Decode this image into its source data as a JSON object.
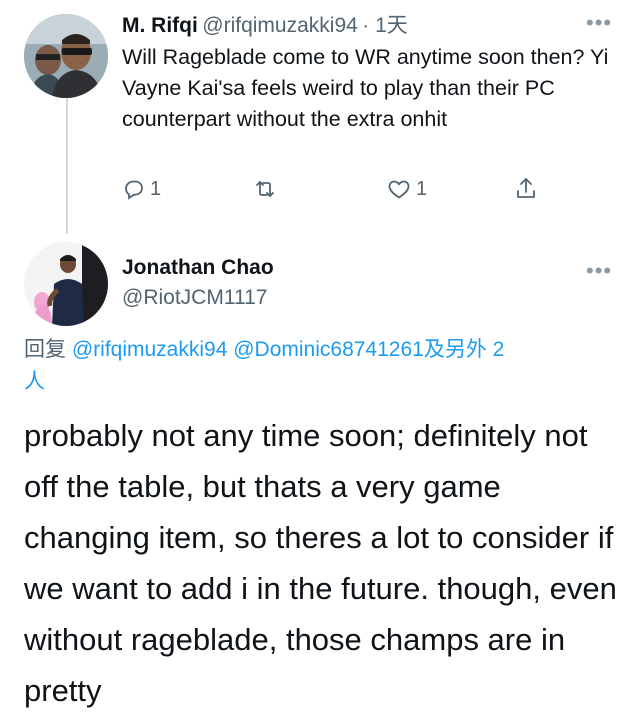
{
  "tweet1": {
    "author_name": "M. Rifqi",
    "author_handle": "@rifqimuzakki94",
    "time": "· 1天",
    "more": "•••",
    "text": "Will Rageblade come to WR anytime soon then? Yi Vayne Kai'sa feels weird to play than their PC counterpart without the extra onhit",
    "reply_count": "1",
    "like_count": "1"
  },
  "tweet2": {
    "author_name": "Jonathan Chao",
    "author_handle": "@RiotJCM1117",
    "more": "•••",
    "replying_label": "回复",
    "mention1": "@rifqimuzakki94",
    "mention2": "@Dominic68741261",
    "replying_suffix": "及另外 2",
    "replying_tail": "人",
    "text": "probably not any time soon; definitely not off the table, but thats a very game changing item, so theres a lot to consider if we want to add i in the future. though, even without rageblade, those champs are in pretty"
  },
  "colors": {
    "text": "#0f1419",
    "secondary": "#536471",
    "accent": "#1d9bf0"
  },
  "icons": [
    "reply-icon",
    "retweet-icon",
    "like-icon",
    "share-icon",
    "more-icon"
  ]
}
